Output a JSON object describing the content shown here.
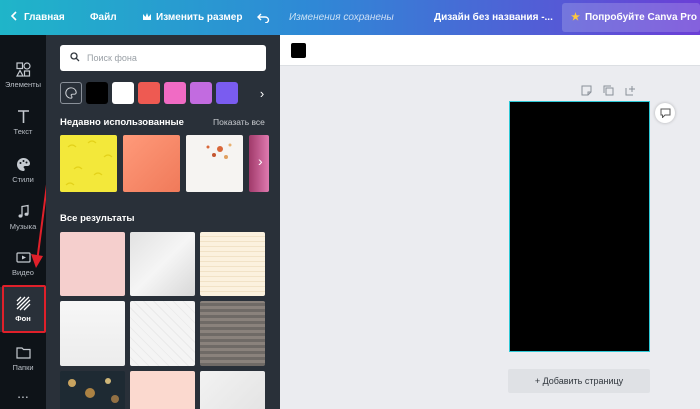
{
  "topbar": {
    "home_label": "Главная",
    "file_label": "Файл",
    "resize_label": "Изменить размер",
    "saved_status": "Изменения сохранены",
    "design_title": "Дизайн без названия -...",
    "pro_label": "Попробуйте Canva Pro",
    "pro_star_color": "#ffc83d"
  },
  "leftnav": {
    "items": [
      {
        "label": "Элементы",
        "icon": "shapes-icon"
      },
      {
        "label": "Текст",
        "icon": "text-icon"
      },
      {
        "label": "Стили",
        "icon": "palette-icon"
      },
      {
        "label": "Музыка",
        "icon": "music-icon"
      },
      {
        "label": "Видео",
        "icon": "video-icon"
      },
      {
        "label": "Фон",
        "icon": "background-icon",
        "active": true
      },
      {
        "label": "Папки",
        "icon": "folder-icon"
      }
    ],
    "more_label": "..."
  },
  "panel": {
    "search_placeholder": "Поиск фона",
    "swatch_colors": [
      "#000000",
      "#ffffff",
      "#ee5a52",
      "#f06bc4",
      "#c26be0",
      "#7a5cf0"
    ],
    "recent_title": "Недавно использованные",
    "show_all_label": "Показать все",
    "results_title": "Все результаты"
  },
  "toolbar": {
    "selected_color": "#000000"
  },
  "canvas": {
    "page_background": "#000000",
    "add_page_label": "+ Добавить страницу"
  },
  "colors": {
    "accent_selection": "#2ec8d6",
    "highlight_red": "#e0202a",
    "panel_bg": "#293039",
    "nav_bg": "#0e1318"
  }
}
